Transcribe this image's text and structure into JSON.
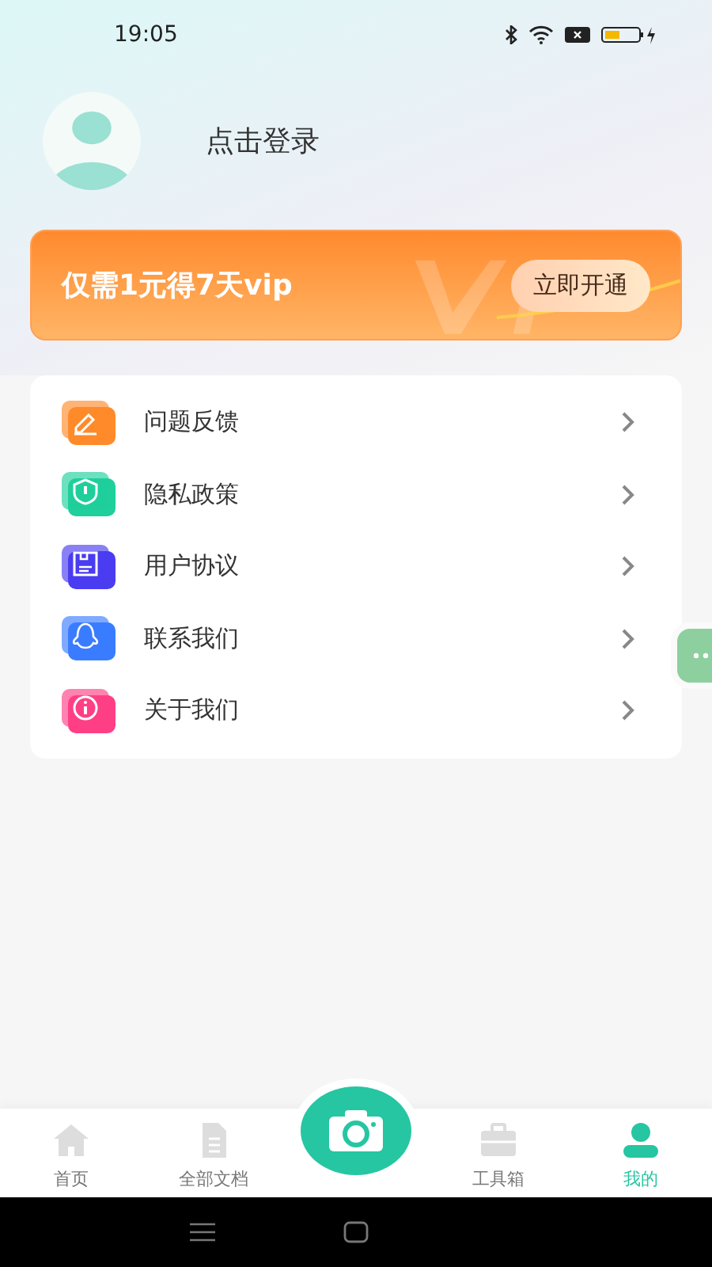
{
  "status_bar": {
    "time": "19:05"
  },
  "profile": {
    "login_label": "点击登录"
  },
  "vip_banner": {
    "text": "仅需1元得7天vip",
    "button": "立即开通"
  },
  "menu": [
    {
      "label": "问题反馈",
      "kind": "feedback",
      "color": "#ff8a2a"
    },
    {
      "label": "隐私政策",
      "kind": "privacy",
      "color": "#1fcf9c"
    },
    {
      "label": "用户协议",
      "kind": "agreement",
      "color": "#4a3cf0"
    },
    {
      "label": "联系我们",
      "kind": "contact",
      "color": "#3a7cff"
    },
    {
      "label": "关于我们",
      "kind": "about",
      "color": "#ff3f85"
    }
  ],
  "tabs": [
    {
      "label": "首页",
      "kind": "home",
      "selected": false
    },
    {
      "label": "全部文档",
      "kind": "docs",
      "selected": false
    },
    {
      "kind": "camera",
      "selected": false
    },
    {
      "label": "工具箱",
      "kind": "tools",
      "selected": false
    },
    {
      "label": "我的",
      "kind": "me",
      "selected": true
    }
  ]
}
